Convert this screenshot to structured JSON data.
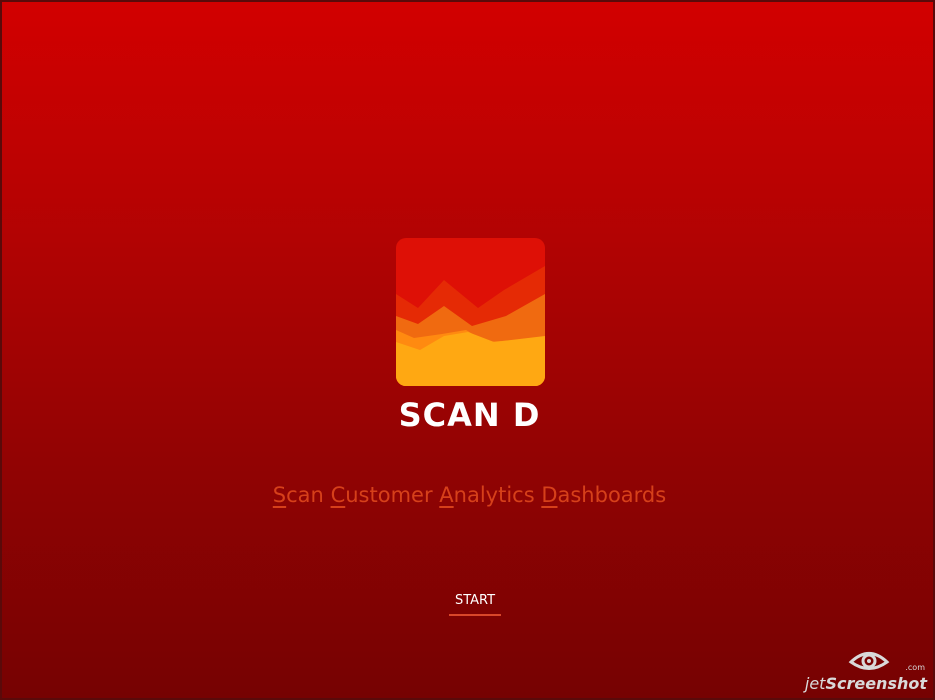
{
  "app": {
    "title": "SCAN D",
    "tagline_words": [
      {
        "initial": "S",
        "rest": "can"
      },
      {
        "initial": "C",
        "rest": "ustomer"
      },
      {
        "initial": "A",
        "rest": "nalytics"
      },
      {
        "initial": "D",
        "rest": "ashboards"
      }
    ],
    "start_label": "START"
  },
  "watermark": {
    "prefix": "jet",
    "brand": "Screenshot",
    "suffix": ".com"
  },
  "icons": {
    "logo": "area-chart-logo-icon",
    "watermark": "eye-icon"
  },
  "colors": {
    "background_top": "#d20000",
    "background_bottom": "#760202",
    "tagline": "#d6401a",
    "start_underline": "#d9472a",
    "logo_back": "#e52a05",
    "logo_mid": "#f06a10",
    "logo_front": "#ffa812"
  }
}
